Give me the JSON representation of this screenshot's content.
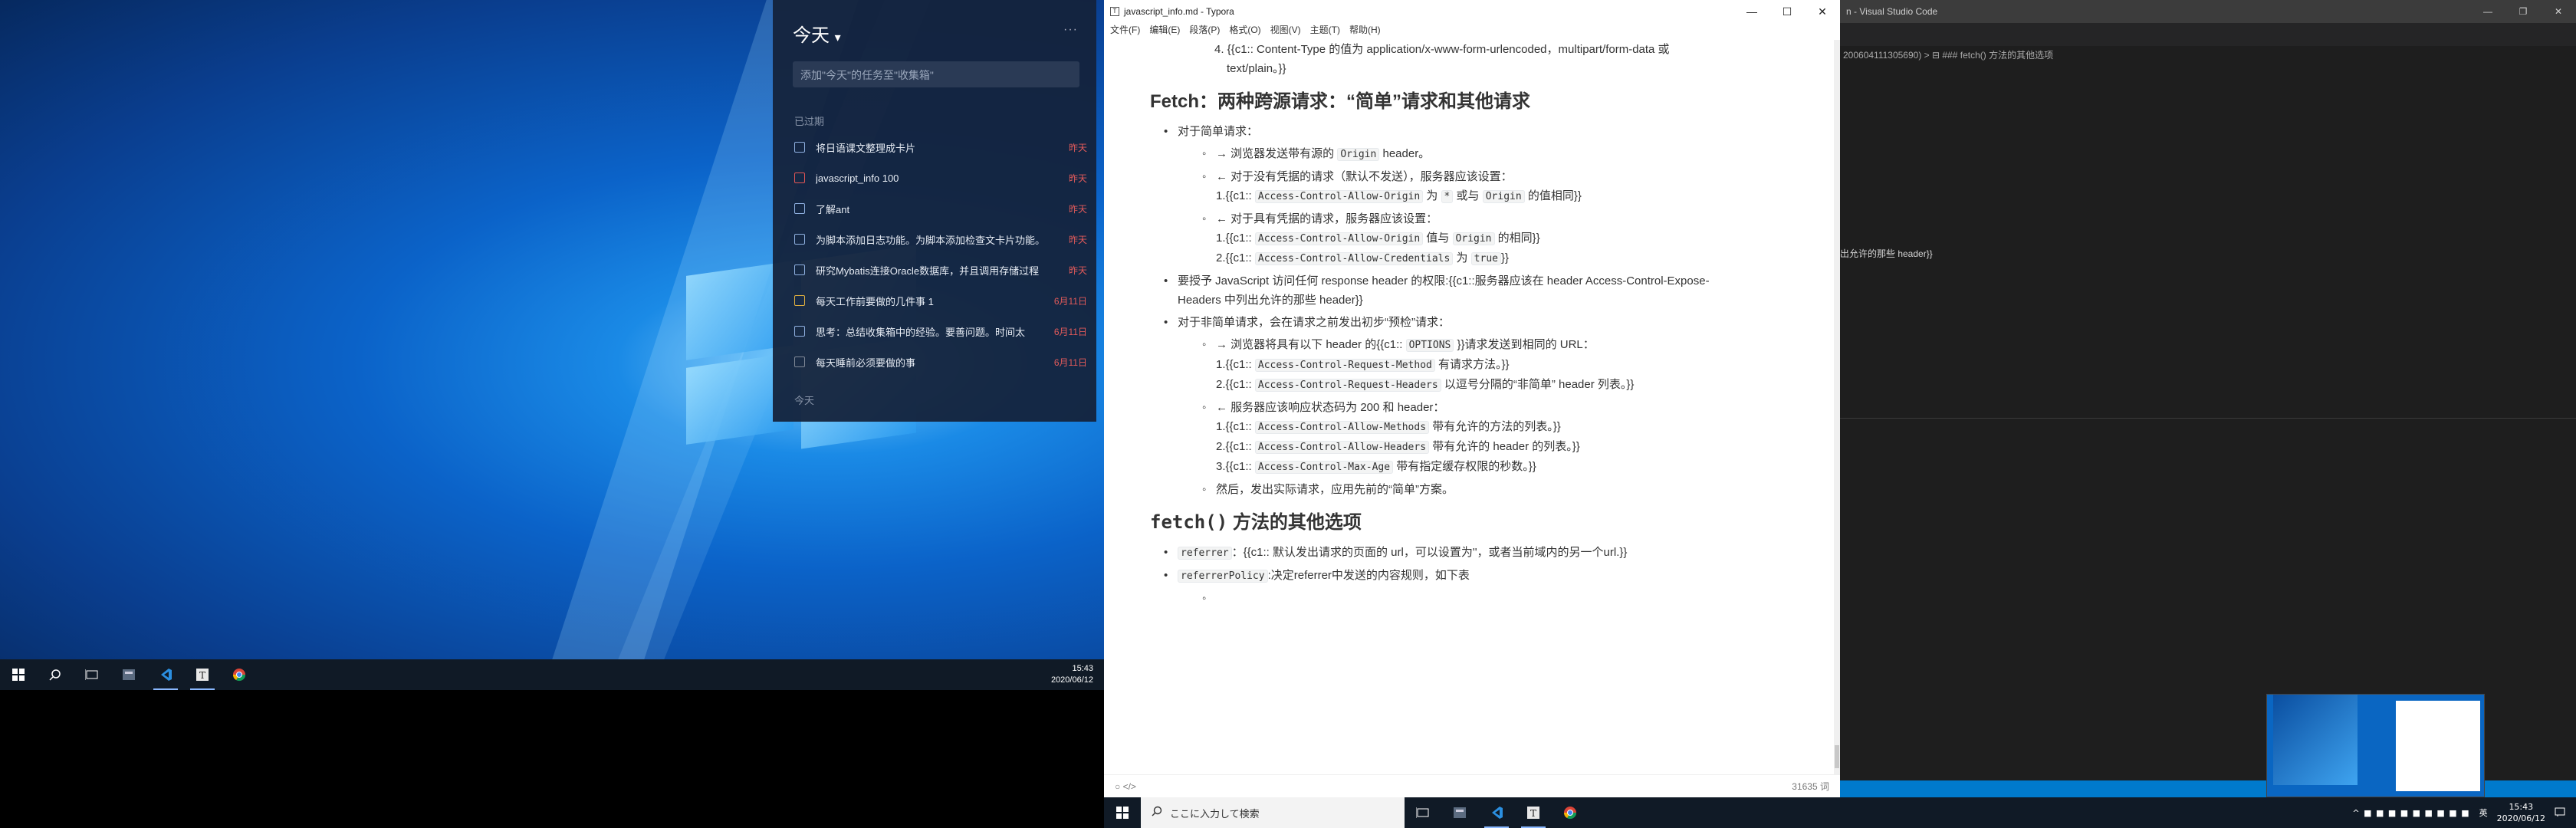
{
  "monitor1": {
    "todo": {
      "title": "今天",
      "title_caret": "▾",
      "more": "···",
      "add_placeholder": "添加\"今天\"的任务至\"收集箱\"",
      "overdue_section": "已过期",
      "today_section": "今天",
      "items": [
        {
          "text": "将日语课文整理成卡片",
          "due": "昨天",
          "checkbox": "blue"
        },
        {
          "text": "javascript_info 100",
          "due": "昨天",
          "checkbox": "red"
        },
        {
          "text": "了解ant",
          "due": "昨天",
          "checkbox": "blue"
        },
        {
          "text": "为脚本添加日志功能。为脚本添加检查文卡片功能。",
          "due": "昨天",
          "checkbox": "blue"
        },
        {
          "text": "研究Mybatis连接Oracle数据库，并且调用存储过程",
          "due": "昨天",
          "checkbox": "blue"
        },
        {
          "text": "每天工作前要做的几件事 1",
          "due": "6月11日",
          "checkbox": "yellow"
        },
        {
          "text": "思考：总结收集箱中的经验。要善问题。时间太",
          "due": "6月11日",
          "checkbox": "blue"
        },
        {
          "text": "每天睡前必须要做的事",
          "due": "6月11日",
          "checkbox": "grey"
        }
      ]
    },
    "clock": {
      "time": "15:43",
      "date": "2020/06/12"
    },
    "taskbar_icons": [
      "start-icon",
      "search-icon",
      "task-view-icon",
      "app-icon",
      "vscode-icon",
      "typora-icon",
      "chrome-icon"
    ]
  },
  "typora": {
    "title": "javascript_info.md - Typora",
    "window_buttons": [
      "—",
      "☐",
      "✕"
    ],
    "menu": [
      "文件(F)",
      "编辑(E)",
      "段落(P)",
      "格式(O)",
      "视图(V)",
      "主题(T)",
      "帮助(H)"
    ],
    "content": {
      "item4_line1": "4. {{c1:: Content-Type 的值为 application/x-www-form-urlencoded，multipart/form-data 或",
      "item4_line2": "text/plain。}}",
      "h_fetch_cors": "Fetch：两种跨源请求：“简单”请求和其他请求",
      "simple": "对于简单请求：",
      "s1_pre": "→ 浏览器发送带有源的 ",
      "s1_code": "Origin",
      "s1_post": " header。",
      "s2": "← 对于没有凭据的请求（默认不发送），服务器应该设置：",
      "s2_n1_pre": "1.{{c1:: ",
      "s2_n1_code": "Access-Control-Allow-Origin",
      "s2_n1_mid": " 为 ",
      "s2_n1_code2": "*",
      "s2_n1_mid2": " 或与 ",
      "s2_n1_code3": "Origin",
      "s2_n1_post": " 的值相同}}",
      "s3": "← 对于具有凭据的请求，服务器应该设置：",
      "s3_n1_pre": "1.{{c1:: ",
      "s3_n1_code": "Access-Control-Allow-Origin",
      "s3_n1_mid": " 值与 ",
      "s3_n1_code2": "Origin",
      "s3_n1_post": " 的相同}}",
      "s3_n2_pre": "2.{{c1:: ",
      "s3_n2_code": "Access-Control-Allow-Credentials",
      "s3_n2_mid": " 为 ",
      "s3_n2_code2": "true",
      "s3_n2_post": "}}",
      "grant_line1": "要授予 JavaScript 访问任何 response header 的权限:{{c1::服务器应该在 header Access-Control-Expose-",
      "grant_line2": "Headers 中列出允许的那些 header}}",
      "nonsimple": "对于非简单请求，会在请求之前发出初步“预检”请求：",
      "n1_pre": "→ 浏览器将具有以下 header 的{{c1:: ",
      "n1_code": "OPTIONS",
      "n1_post": " }}请求发送到相同的 URL：",
      "n1_a_pre": "1.{{c1:: ",
      "n1_a_code": "Access-Control-Request-Method",
      "n1_a_post": " 有请求方法。}}",
      "n1_b_pre": "2.{{c1:: ",
      "n1_b_code": "Access-Control-Request-Headers",
      "n1_b_post": " 以逗号分隔的“非简单” header 列表。}}",
      "n2": "← 服务器应该响应状态码为 200 和 header：",
      "n2_a_pre": "1.{{c1:: ",
      "n2_a_code": "Access-Control-Allow-Methods",
      "n2_a_post": " 带有允许的方法的列表。}}",
      "n2_b_pre": "2.{{c1:: ",
      "n2_b_code": "Access-Control-Allow-Headers",
      "n2_b_post": " 带有允许的 header 的列表。}}",
      "n2_c_pre": "3.{{c1:: ",
      "n2_c_code": "Access-Control-Max-Age",
      "n2_c_post": " 带有指定缓存权限的秒数。}}",
      "n3": "然后，发出实际请求，应用先前的“简单”方案。",
      "h_fetch_opts_code": "fetch()",
      "h_fetch_opts_text": " 方法的其他选项",
      "ref_code": "referrer",
      "ref_text": "：{{c1:: 默认发出请求的页面的 url，可以设置为''，或者当前域内的另一个url.}}",
      "refpol_code": "referrerPolicy",
      "refpol_text": ":决定referrer中发送的内容规则，如下表"
    },
    "status_left": "○  </>",
    "word_count": "31635 词"
  },
  "taskbar2": {
    "search_placeholder": "ここに入力して検索",
    "time": "15:43",
    "date": "2020/06/12",
    "ime": "英",
    "tray": "^ ■ ■ ■ ■ ■ ■ ■ ■ ■"
  },
  "vscode": {
    "title": "n - Visual Studio Code",
    "window_buttons": [
      "—",
      "❐",
      "✕"
    ],
    "breadcrumb": "200604111305690) > ⊟ ### fetch() 方法的其他选项",
    "code_line": "出允许的那些 header}}"
  }
}
